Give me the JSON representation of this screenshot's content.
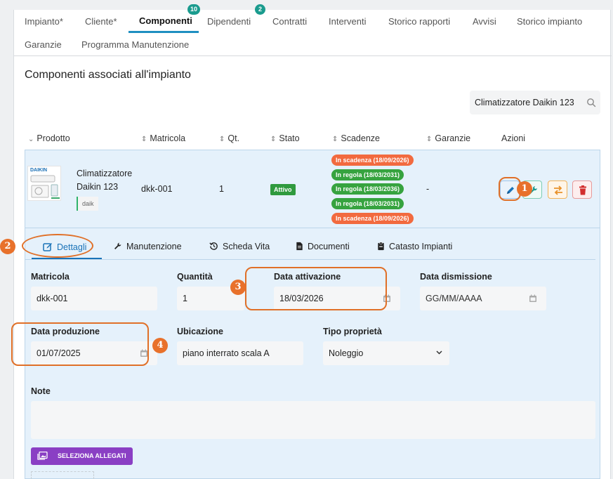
{
  "tabs": [
    {
      "label": "Impianto*"
    },
    {
      "label": "Cliente*"
    },
    {
      "label": "Componenti",
      "badge": "10"
    },
    {
      "label": "Dipendenti"
    },
    {
      "label": "Contratti",
      "badge": "2"
    },
    {
      "label": "Interventi"
    },
    {
      "label": "Storico rapporti"
    },
    {
      "label": "Avvisi"
    },
    {
      "label": "Storico impianto"
    },
    {
      "label": "Garanzie"
    },
    {
      "label": "Programma Manutenzione"
    }
  ],
  "section_title": "Componenti associati all'impianto",
  "search": {
    "value": "Climatizzatore Daikin 123"
  },
  "columns": [
    "Prodotto",
    "Matricola",
    "Qt.",
    "Stato",
    "Scadenze",
    "Garanzie",
    "Azioni"
  ],
  "row": {
    "brand": "DAIKIN",
    "product_name": "Climatizzatore Daikin 123",
    "product_tag": "daik",
    "matricola": "dkk-001",
    "qty": "1",
    "status": "Attivo",
    "garanzie": "-",
    "deadlines": [
      {
        "label": "In scadenza (18/09/2026)",
        "color": "#f26a3f"
      },
      {
        "label": "In regola (18/03/2031)",
        "color": "#36a33f"
      },
      {
        "label": "In regola (18/03/2036)",
        "color": "#36a33f"
      },
      {
        "label": "In regola (18/03/2031)",
        "color": "#36a33f"
      },
      {
        "label": "In scadenza (18/09/2026)",
        "color": "#f26a3f"
      }
    ]
  },
  "subtabs": [
    "Dettagli",
    "Manutenzione",
    "Scheda Vita",
    "Documenti",
    "Catasto Impianti"
  ],
  "form": {
    "matricola": {
      "label": "Matricola",
      "value": "dkk-001"
    },
    "quantita": {
      "label": "Quantità",
      "value": "1"
    },
    "data_attivazione": {
      "label": "Data attivazione",
      "value": "18/03/2026"
    },
    "data_dismissione": {
      "label": "Data dismissione",
      "placeholder": "GG/MM/AAAA"
    },
    "data_produzione": {
      "label": "Data produzione",
      "value": "01/07/2025"
    },
    "ubicazione": {
      "label": "Ubicazione",
      "value": "piano interrato scala A"
    },
    "tipo_proprieta": {
      "label": "Tipo proprietà",
      "value": "Noleggio"
    },
    "note": {
      "label": "Note",
      "value": ""
    },
    "attach_label": "SELEZIONA ALLEGATI"
  },
  "callouts": [
    "1",
    "2",
    "3",
    "4"
  ],
  "colors": {
    "accent": "#1f8fc1",
    "badge": "#1a9b8e",
    "callout": "#e8712b",
    "attach": "#8a3fc4"
  }
}
